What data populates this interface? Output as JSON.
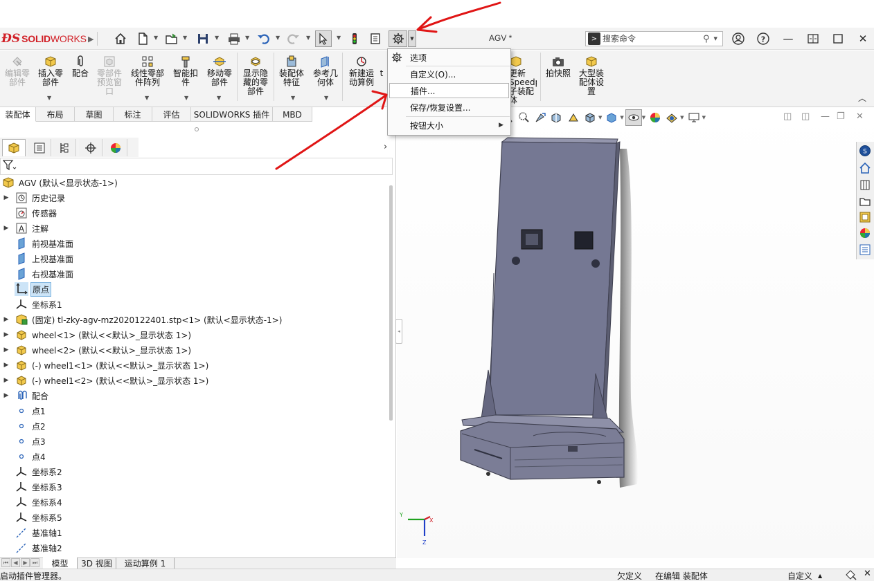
{
  "app": {
    "brand_prefix": "SOLID",
    "brand_suffix": "WORKS",
    "document_title": "AGV *"
  },
  "search": {
    "placeholder": "搜索命令"
  },
  "ribbon": {
    "buttons": [
      {
        "label": "编辑零\n部件",
        "disabled": true
      },
      {
        "label": "插入零\n部件"
      },
      {
        "label": "配合"
      },
      {
        "label": "零部件\n预览窗\n口",
        "disabled": true
      },
      {
        "label": "线性零部\n件阵列"
      },
      {
        "label": "智能扣\n件"
      },
      {
        "label": "移动零\n部件"
      },
      {
        "label": "显示隐\n藏的零\n部件"
      },
      {
        "label": "装配体\n特征"
      },
      {
        "label": "参考几\n何体"
      },
      {
        "label": "新建运\n动算例"
      },
      {
        "label": "t"
      },
      {
        "label": "更新\nSpeedpak\n子装配\n体"
      },
      {
        "label": "拍快照"
      },
      {
        "label": "大型装\n配体设\n置"
      }
    ]
  },
  "command_tabs": [
    "装配体",
    "布局",
    "草图",
    "标注",
    "评估",
    "SOLIDWORKS 插件",
    "MBD"
  ],
  "options_menu": {
    "items": [
      "选项",
      "自定义(O)...",
      "插件...",
      "保存/恢复设置...",
      "按钮大小"
    ]
  },
  "tree": {
    "root": "AGV  (默认<显示状态-1>)",
    "items": [
      "历史记录",
      "传感器",
      "注解",
      "前视基准面",
      "上视基准面",
      "右视基准面",
      "原点",
      "坐标系1",
      "(固定) tl-zky-agv-mz2020122401.stp<1> (默认<显示状态-1>)",
      "wheel<1> (默认<<默认>_显示状态 1>)",
      "wheel<2> (默认<<默认>_显示状态 1>)",
      "(-) wheel1<1> (默认<<默认>_显示状态 1>)",
      "(-) wheel1<2> (默认<<默认>_显示状态 1>)",
      "配合",
      "点1",
      "点2",
      "点3",
      "点4",
      "坐标系2",
      "坐标系3",
      "坐标系4",
      "坐标系5",
      "基准轴1",
      "基准轴2"
    ]
  },
  "bottom_tabs": [
    "模型",
    "3D 视图",
    "运动算例 1"
  ],
  "status": {
    "message": "启动插件管理器。",
    "underdefined": "欠定义",
    "editing": "在编辑 装配体",
    "units": "自定义"
  },
  "colors": {
    "brand_red": "#d11f26",
    "annotation_red": "#e01515",
    "selection_blue": "#cce4f7"
  }
}
